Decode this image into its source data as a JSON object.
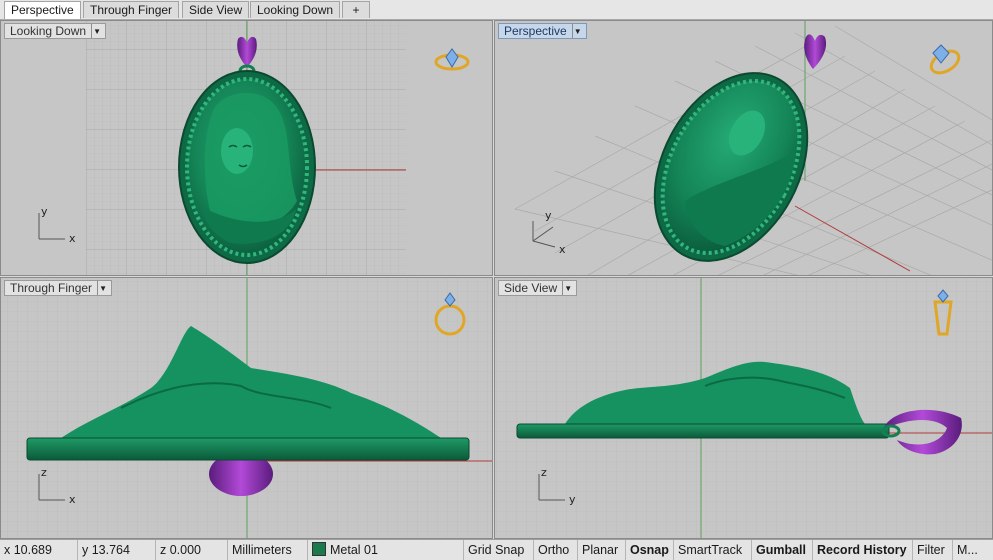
{
  "tabs": [
    {
      "label": "Perspective",
      "active": true
    },
    {
      "label": "Through Finger",
      "active": false
    },
    {
      "label": "Side View",
      "active": false
    },
    {
      "label": "Looking Down",
      "active": false
    }
  ],
  "add_tab_glyph": "+",
  "viewports": {
    "top_left": {
      "label": "Looking Down",
      "axes": [
        "y",
        "x"
      ]
    },
    "top_right": {
      "label": "Perspective",
      "axes": [
        "y",
        "x"
      ],
      "active": true
    },
    "bottom_left": {
      "label": "Through Finger",
      "axes": [
        "z",
        "x"
      ]
    },
    "bottom_right": {
      "label": "Side View",
      "axes": [
        "z",
        "y"
      ]
    }
  },
  "dropdown_glyph": "▼",
  "status": {
    "x": "x 10.689",
    "y": "y 13.764",
    "z": "z 0.000",
    "units": "Millimeters",
    "layer": "Metal 01",
    "toggles": [
      "Grid Snap",
      "Ortho",
      "Planar",
      "Osnap",
      "SmartTrack",
      "Gumball",
      "Record History",
      "Filter",
      "M..."
    ],
    "bold_toggles": [
      "Osnap",
      "Gumball",
      "Record History"
    ]
  },
  "colors": {
    "model_green": "#16845a",
    "bail_purple": "#8a2fb0",
    "viewport_bg": "#c6c6c6",
    "active_label": "#c7d7ea",
    "gizmo": "#e0a626"
  }
}
